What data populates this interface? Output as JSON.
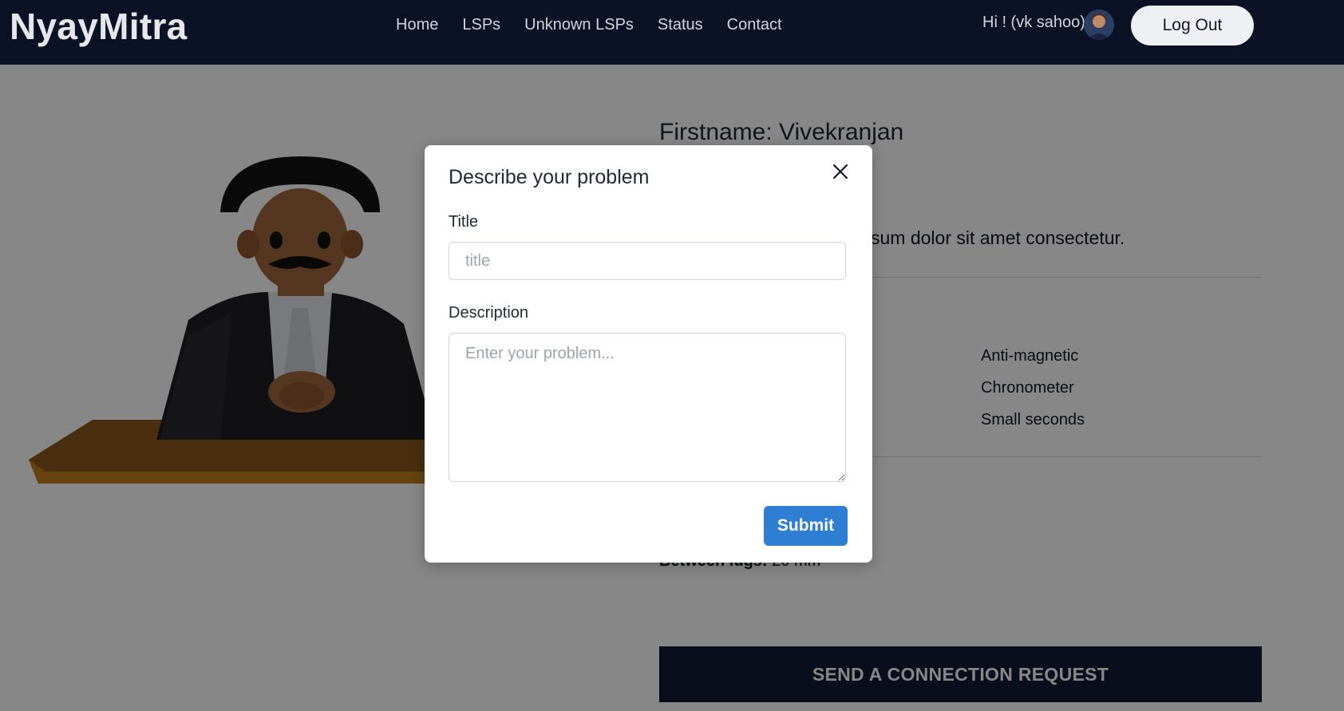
{
  "brand": "NyayMitra",
  "nav": {
    "links": [
      "Home",
      "LSPs",
      "Unknown LSPs",
      "Status",
      "Contact"
    ],
    "greeting": "Hi ! (vk sahoo)",
    "logout_label": "Log Out"
  },
  "profile": {
    "firstname": "Firstname: Vivekranjan",
    "description_fragment": "sum dolor sit amet consectetur.",
    "features": [
      "Anti-magnetic",
      "Chronometer",
      "Small seconds"
    ],
    "lugs_label": "Between lugs:",
    "lugs_value": " 20 mm",
    "connect_label": "SEND A CONNECTION REQUEST"
  },
  "modal": {
    "title": "Describe your problem",
    "title_label": "Title",
    "title_placeholder": "title",
    "description_label": "Description",
    "description_placeholder": "Enter your problem...",
    "submit_label": "Submit"
  },
  "colors": {
    "navbar": "#0b1226",
    "submit": "#2e7fd4",
    "connect": "#141a33"
  }
}
